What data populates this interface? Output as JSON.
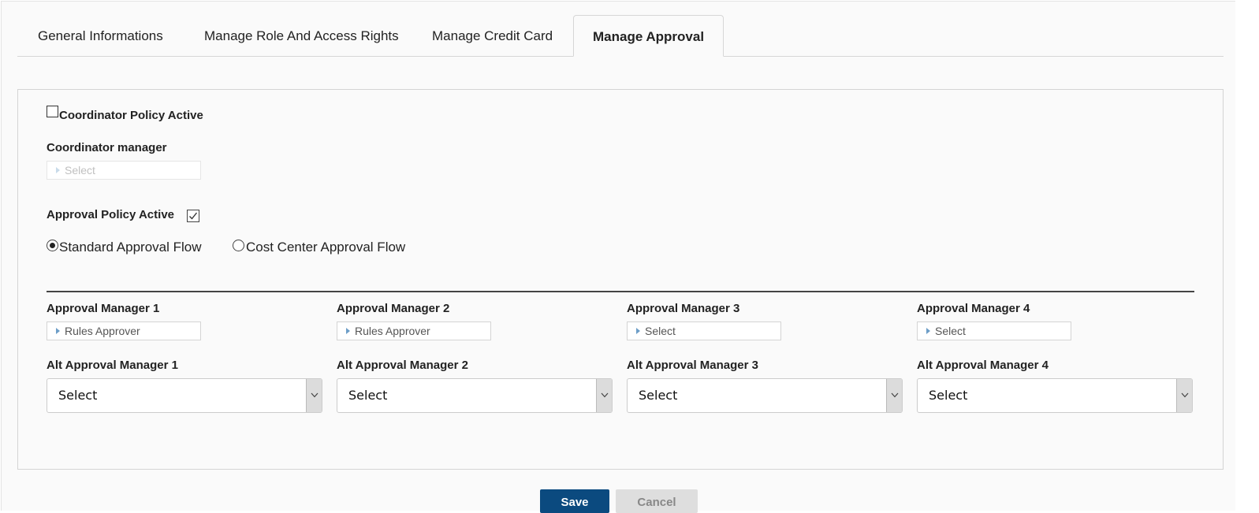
{
  "tabs": [
    {
      "label": "General Informations",
      "active": false
    },
    {
      "label": "Manage Role And Access Rights",
      "active": false
    },
    {
      "label": "Manage Credit Card",
      "active": false
    },
    {
      "label": "Manage Approval",
      "active": true
    }
  ],
  "coordinator": {
    "policy_label": "Coordinator Policy Active",
    "policy_checked": false,
    "manager_label": "Coordinator manager",
    "manager_value": "Select"
  },
  "approval": {
    "policy_label": "Approval Policy Active",
    "policy_checked": true,
    "flow_options": [
      {
        "label": "Standard Approval Flow",
        "selected": true
      },
      {
        "label": "Cost Center Approval Flow",
        "selected": false
      }
    ]
  },
  "managers": [
    {
      "label": "Approval Manager 1",
      "value": "Rules Approver"
    },
    {
      "label": "Approval Manager 2",
      "value": "Rules Approver"
    },
    {
      "label": "Approval Manager 3",
      "value": "Select"
    },
    {
      "label": "Approval Manager 4",
      "value": "Select"
    }
  ],
  "alt_managers": [
    {
      "label": "Alt Approval Manager 1",
      "value": "Select"
    },
    {
      "label": "Alt Approval Manager 2",
      "value": "Select"
    },
    {
      "label": "Alt Approval Manager 3",
      "value": "Select"
    },
    {
      "label": "Alt Approval Manager 4",
      "value": "Select"
    }
  ],
  "buttons": {
    "save": "Save",
    "cancel": "Cancel"
  },
  "colors": {
    "primary": "#0b4a7f",
    "secondary": "#dedede",
    "accent": "#6d9ec8"
  }
}
